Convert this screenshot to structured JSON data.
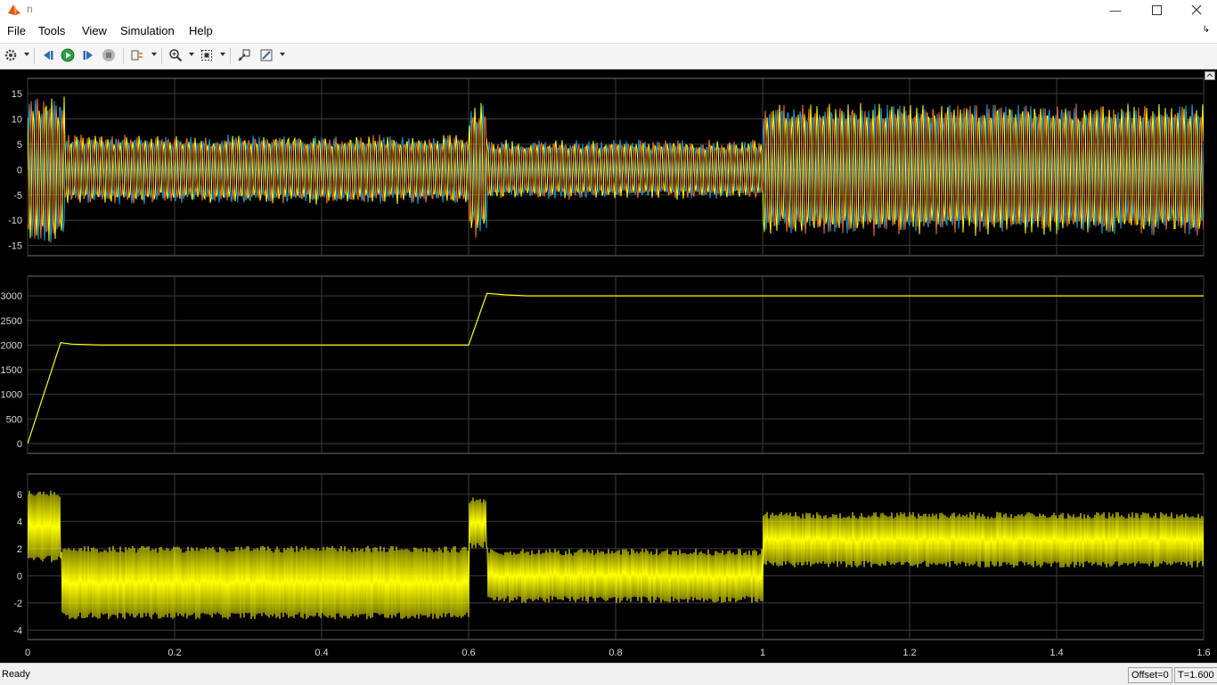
{
  "window": {
    "title": "n"
  },
  "menu": {
    "items": [
      "File",
      "Tools",
      "View",
      "Simulation",
      "Help"
    ]
  },
  "toolbar": {
    "buttons": [
      "settings-icon",
      "step-back-icon",
      "run-icon",
      "step-forward-icon",
      "stop-icon",
      "signal-selector-icon",
      "zoom-icon",
      "autoscale-icon",
      "highlight-block-icon",
      "style-icon"
    ]
  },
  "colors": {
    "yellow": "#ffff00",
    "orange": "#ff6a28",
    "blue": "#0ba3e6",
    "grid": "#3c3c3c",
    "axes_bg": "#000000"
  },
  "chart_data": [
    {
      "type": "line",
      "title": "",
      "xlim": [
        0,
        1.6
      ],
      "ylim": [
        -17,
        18
      ],
      "yticks": [
        -15,
        -10,
        -5,
        0,
        5,
        10,
        15
      ],
      "grid": true,
      "series": [
        {
          "color": "#0ba3e6",
          "envelope": [
            [
              0,
              15
            ],
            [
              0.05,
              15
            ],
            [
              0.05,
              7
            ],
            [
              0.6,
              7
            ],
            [
              0.6,
              14
            ],
            [
              0.625,
              14
            ],
            [
              0.625,
              6
            ],
            [
              1.0,
              6
            ],
            [
              1.0,
              11
            ],
            [
              1.6,
              11
            ]
          ]
        },
        {
          "color": "#ffff00",
          "envelope": [
            [
              0,
              15
            ],
            [
              0.05,
              15
            ],
            [
              0.05,
              7
            ],
            [
              0.6,
              7
            ],
            [
              0.6,
              14
            ],
            [
              0.625,
              14
            ],
            [
              0.625,
              6
            ],
            [
              1.0,
              6
            ],
            [
              1.0,
              11
            ],
            [
              1.6,
              11
            ]
          ]
        },
        {
          "color": "#ff6a28",
          "envelope": [
            [
              0,
              15
            ],
            [
              0.05,
              15
            ],
            [
              0.05,
              7
            ],
            [
              0.6,
              7
            ],
            [
              0.6,
              14
            ],
            [
              0.625,
              14
            ],
            [
              0.625,
              6
            ],
            [
              1.0,
              6
            ],
            [
              1.0,
              11
            ],
            [
              1.6,
              11
            ]
          ]
        }
      ]
    },
    {
      "type": "line",
      "title": "",
      "xlim": [
        0,
        1.6
      ],
      "ylim": [
        -200,
        3400
      ],
      "yticks": [
        0,
        500,
        1000,
        1500,
        2000,
        2500,
        3000
      ],
      "grid": true,
      "series": [
        {
          "color": "#ffff00",
          "x": [
            0,
            0.045,
            0.06,
            0.1,
            0.6,
            0.625,
            0.65,
            0.68,
            1.6
          ],
          "y": [
            0,
            2050,
            2020,
            2000,
            2000,
            3050,
            3020,
            3000,
            3000
          ]
        }
      ]
    },
    {
      "type": "line",
      "title": "",
      "xlim": [
        0,
        1.6
      ],
      "ylim": [
        -4.7,
        7.5
      ],
      "yticks": [
        -4,
        -2,
        0,
        2,
        4,
        6
      ],
      "xticks": [
        0,
        0.2,
        0.4,
        0.6,
        0.8,
        1,
        1.2,
        1.4,
        1.6
      ],
      "grid": true,
      "series": [
        {
          "color": "#ffff00",
          "bands": [
            {
              "x": [
                0,
                0.045
              ],
              "lo": 1.0,
              "hi": 6.3
            },
            {
              "x": [
                0.045,
                0.6
              ],
              "lo": -3.2,
              "hi": 2.2
            },
            {
              "x": [
                0.6,
                0.625
              ],
              "lo": 2.0,
              "hi": 5.8
            },
            {
              "x": [
                0.625,
                1.0
              ],
              "lo": -2.0,
              "hi": 2.0
            },
            {
              "x": [
                1.0,
                1.6
              ],
              "lo": 0.6,
              "hi": 4.7
            }
          ]
        }
      ]
    }
  ],
  "status": {
    "text": "Ready",
    "offset": "Offset=0",
    "time": "T=1.600"
  }
}
